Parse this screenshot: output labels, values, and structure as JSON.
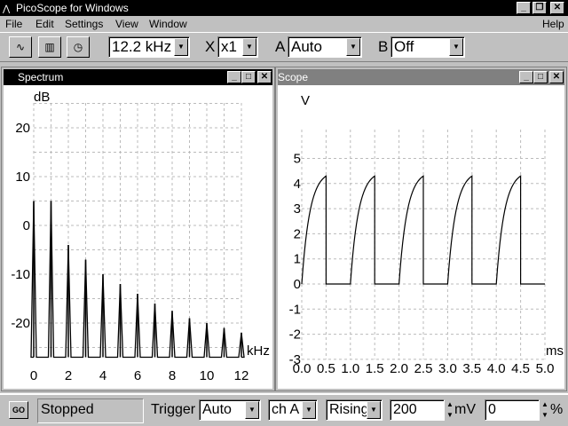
{
  "app": {
    "title": "PicoScope for Windows"
  },
  "menu": [
    "File",
    "Edit",
    "Settings",
    "View",
    "Window"
  ],
  "help": "Help",
  "toolbar": {
    "timebase": "12.2 kHz",
    "x_label": "X",
    "x_value": "x1",
    "a_label": "A",
    "a_value": "Auto",
    "b_label": "B",
    "b_value": "Off"
  },
  "spectrum": {
    "title": "Spectrum",
    "y_unit": "dB",
    "x_unit": "kHz",
    "y_ticks": [
      20,
      10,
      0,
      -10,
      -20
    ],
    "x_ticks": [
      0,
      2,
      4,
      6,
      8,
      10,
      12
    ],
    "chart_data": {
      "type": "bar",
      "xlabel": "kHz",
      "ylabel": "dB",
      "xlim": [
        0,
        12.2
      ],
      "ylim": [
        -27,
        27
      ],
      "x": [
        0,
        1,
        2,
        3,
        4,
        5,
        6,
        7,
        8,
        9,
        10,
        11,
        12
      ],
      "values": [
        5,
        5,
        -4,
        -7,
        -10,
        -12,
        -14,
        -16,
        -17.5,
        -19,
        -20,
        -21,
        -22
      ]
    }
  },
  "scope": {
    "title": "Scope",
    "y_unit": "V",
    "x_unit": "ms",
    "y_ticks": [
      5,
      4,
      3,
      2,
      1,
      0,
      -1,
      -2,
      -3
    ],
    "x_ticks": [
      "0.0",
      "0.5",
      "1.0",
      "1.5",
      "2.0",
      "2.5",
      "3.0",
      "3.5",
      "4.0",
      "4.5",
      "5.0"
    ],
    "chart_data": {
      "type": "line",
      "xlabel": "ms",
      "ylabel": "V",
      "xlim": [
        0,
        5
      ],
      "ylim": [
        -3,
        5.5
      ],
      "period_ms": 1,
      "peak_v": 4.3,
      "duty": 0.5
    }
  },
  "status": {
    "go": "GO",
    "state": "Stopped",
    "trigger_label": "Trigger",
    "trigger_mode": "Auto",
    "channel": "ch A",
    "edge": "Rising",
    "level": "200",
    "level_unit": "mV",
    "delay": "0",
    "delay_unit": "%"
  }
}
